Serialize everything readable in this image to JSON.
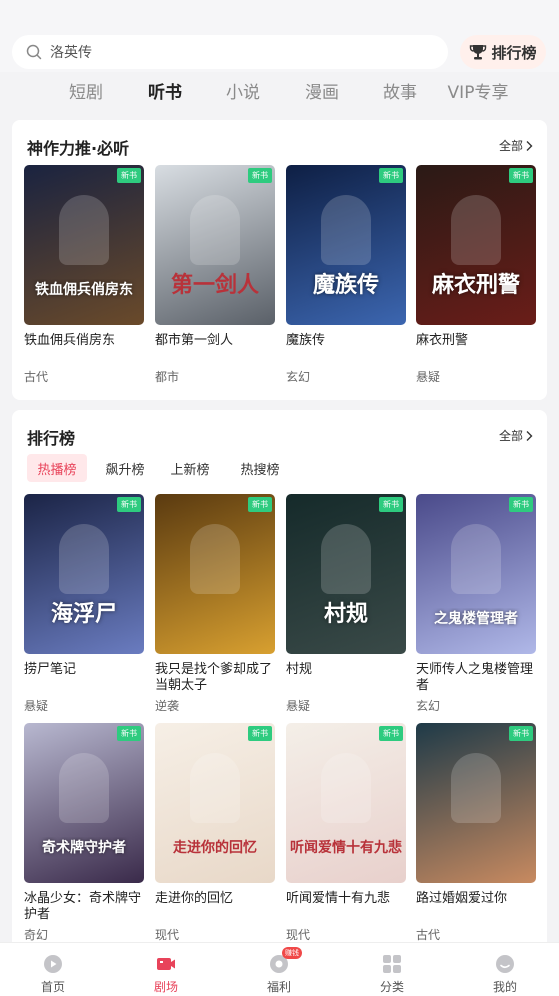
{
  "search": {
    "text": "洛英传"
  },
  "rank_button": {
    "label": "排行榜"
  },
  "tabs": [
    {
      "label": "短剧",
      "active": false
    },
    {
      "label": "听书",
      "active": true
    },
    {
      "label": "小说",
      "active": false
    },
    {
      "label": "漫画",
      "active": false
    },
    {
      "label": "故事",
      "active": false
    },
    {
      "label": "VIP专享",
      "active": false
    }
  ],
  "featured": {
    "title": "神作力推·必听",
    "more": "全部",
    "books": [
      {
        "name": "铁血佣兵俏房东",
        "tag": "古代",
        "badge": "新书",
        "cover_text": "铁血佣兵俏房东",
        "colors": [
          "#1a2340",
          "#6a4a2a"
        ]
      },
      {
        "name": "都市第一剑人",
        "tag": "都市",
        "badge": "新书",
        "cover_text": "第一剑人",
        "colors": [
          "#d8dde2",
          "#5a6068"
        ]
      },
      {
        "name": "魔族传",
        "tag": "玄幻",
        "badge": "新书",
        "cover_text": "魔族传",
        "colors": [
          "#0e1f44",
          "#3c66b0"
        ]
      },
      {
        "name": "麻衣刑警",
        "tag": "悬疑",
        "badge": "新书",
        "cover_text": "麻衣刑警",
        "colors": [
          "#2a1a16",
          "#6a1d18"
        ]
      }
    ]
  },
  "ranking": {
    "title": "排行榜",
    "more": "全部",
    "subtabs": [
      {
        "label": "热播榜",
        "active": true
      },
      {
        "label": "飙升榜",
        "active": false
      },
      {
        "label": "上新榜",
        "active": false
      },
      {
        "label": "热搜榜",
        "active": false
      }
    ],
    "books": [
      {
        "name": "捞尸笔记",
        "tag": "悬疑",
        "badge": "新书",
        "cover_text": "海浮尸",
        "colors": [
          "#1b2446",
          "#6a7cc0"
        ]
      },
      {
        "name": "我只是找个爹却成了当朝太子",
        "tag": "逆袭",
        "badge": "新书",
        "cover_text": "",
        "colors": [
          "#5a3a10",
          "#d8a030"
        ]
      },
      {
        "name": "村规",
        "tag": "悬疑",
        "badge": "新书",
        "cover_text": "村规",
        "colors": [
          "#152a2a",
          "#3a4a48"
        ]
      },
      {
        "name": "天师传人之鬼楼管理者",
        "tag": "玄幻",
        "badge": "新书",
        "cover_text": "之鬼楼管理者",
        "colors": [
          "#4a4a8a",
          "#b0b8e8"
        ]
      },
      {
        "name": "冰晶少女：奇术牌守护者",
        "tag": "奇幻",
        "badge": "新书",
        "cover_text": "奇术牌守护者",
        "colors": [
          "#b8b8d0",
          "#3a2a4a"
        ]
      },
      {
        "name": "走进你的回忆",
        "tag": "现代",
        "badge": "新书",
        "cover_text": "走进你的回忆",
        "colors": [
          "#f6efe6",
          "#e8d8c8"
        ]
      },
      {
        "name": "听闻爱情十有九悲",
        "tag": "现代",
        "badge": "新书",
        "cover_text": "听闻爱情十有九悲",
        "colors": [
          "#f4efe8",
          "#e8d0cc"
        ]
      },
      {
        "name": "路过婚姻爱过你",
        "tag": "古代",
        "badge": "新书",
        "cover_text": "",
        "colors": [
          "#1e3a48",
          "#c88a60"
        ]
      }
    ]
  },
  "bottom_nav": [
    {
      "label": "首页",
      "icon": "home-icon",
      "active": false
    },
    {
      "label": "剧场",
      "icon": "theater-icon",
      "active": true
    },
    {
      "label": "福利",
      "icon": "welfare-icon",
      "active": false,
      "badge": "赚钱"
    },
    {
      "label": "分类",
      "icon": "category-icon",
      "active": false
    },
    {
      "label": "我的",
      "icon": "profile-icon",
      "active": false
    }
  ],
  "colors": {
    "accent": "#e8435a",
    "new_badge": "#2ecb7f",
    "background": "#f3f3f5"
  }
}
